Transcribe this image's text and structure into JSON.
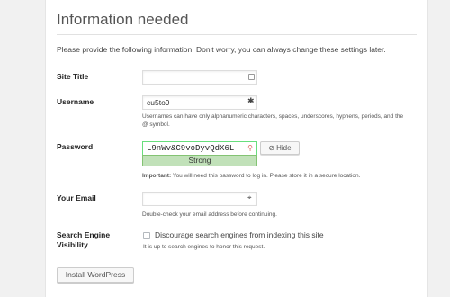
{
  "page": {
    "title": "Information needed",
    "intro": "Please provide the following information. Don't worry, you can always change these settings later."
  },
  "fields": {
    "site_title": {
      "label": "Site Title",
      "value": ""
    },
    "username": {
      "label": "Username",
      "value": "cu5to9",
      "help_line1": "Usernames can have only alphanumeric characters, spaces, underscores, hyphens, periods, and the",
      "help_line2": "@ symbol."
    },
    "password": {
      "label": "Password",
      "value": "L9nWv&C9voDyvQdX6L",
      "strength": "Strong",
      "hide_label": "Hide",
      "note_bold": "Important:",
      "note_rest": " You will need this password to log in. Please store it in a secure location."
    },
    "email": {
      "label": "Your Email",
      "value": "",
      "help": "Double-check your email address before continuing."
    },
    "search_engine": {
      "label_line1": "Search Engine",
      "label_line2": "Visibility",
      "checkbox_label": "Discourage search engines from indexing this site",
      "checked": false,
      "help": "It is up to search engines to honor this request."
    }
  },
  "actions": {
    "install_label": "Install WordPress"
  },
  "icons": {
    "field_icon": "password-manager-icon",
    "username_icon": "keychain-icon",
    "password_icon": "key-icon",
    "email_icon": "autofill-cursor-icon",
    "hide_icon": "eye-slash-icon"
  },
  "colors": {
    "strength_bg": "#c1e1b9",
    "strength_border": "#83c373"
  }
}
